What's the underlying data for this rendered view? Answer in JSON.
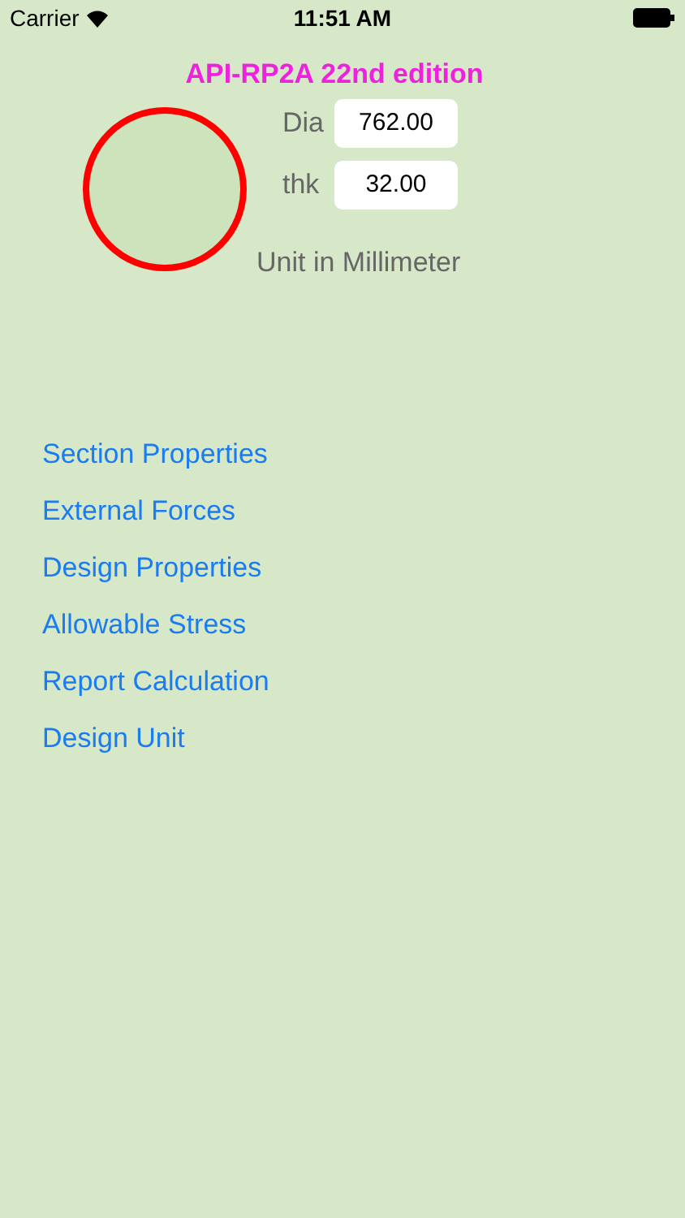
{
  "status_bar": {
    "carrier": "Carrier",
    "time": "11:51 AM"
  },
  "title": "API-RP2A 22nd edition",
  "inputs": [
    {
      "label": "Dia",
      "value": "762.00"
    },
    {
      "label": "thk",
      "value": "32.00"
    }
  ],
  "unit_note": "Unit in Millimeter",
  "menu": [
    "Section Properties",
    "External Forces",
    "Design Properties",
    "Allowable Stress",
    "Report Calculation",
    "Design Unit"
  ]
}
